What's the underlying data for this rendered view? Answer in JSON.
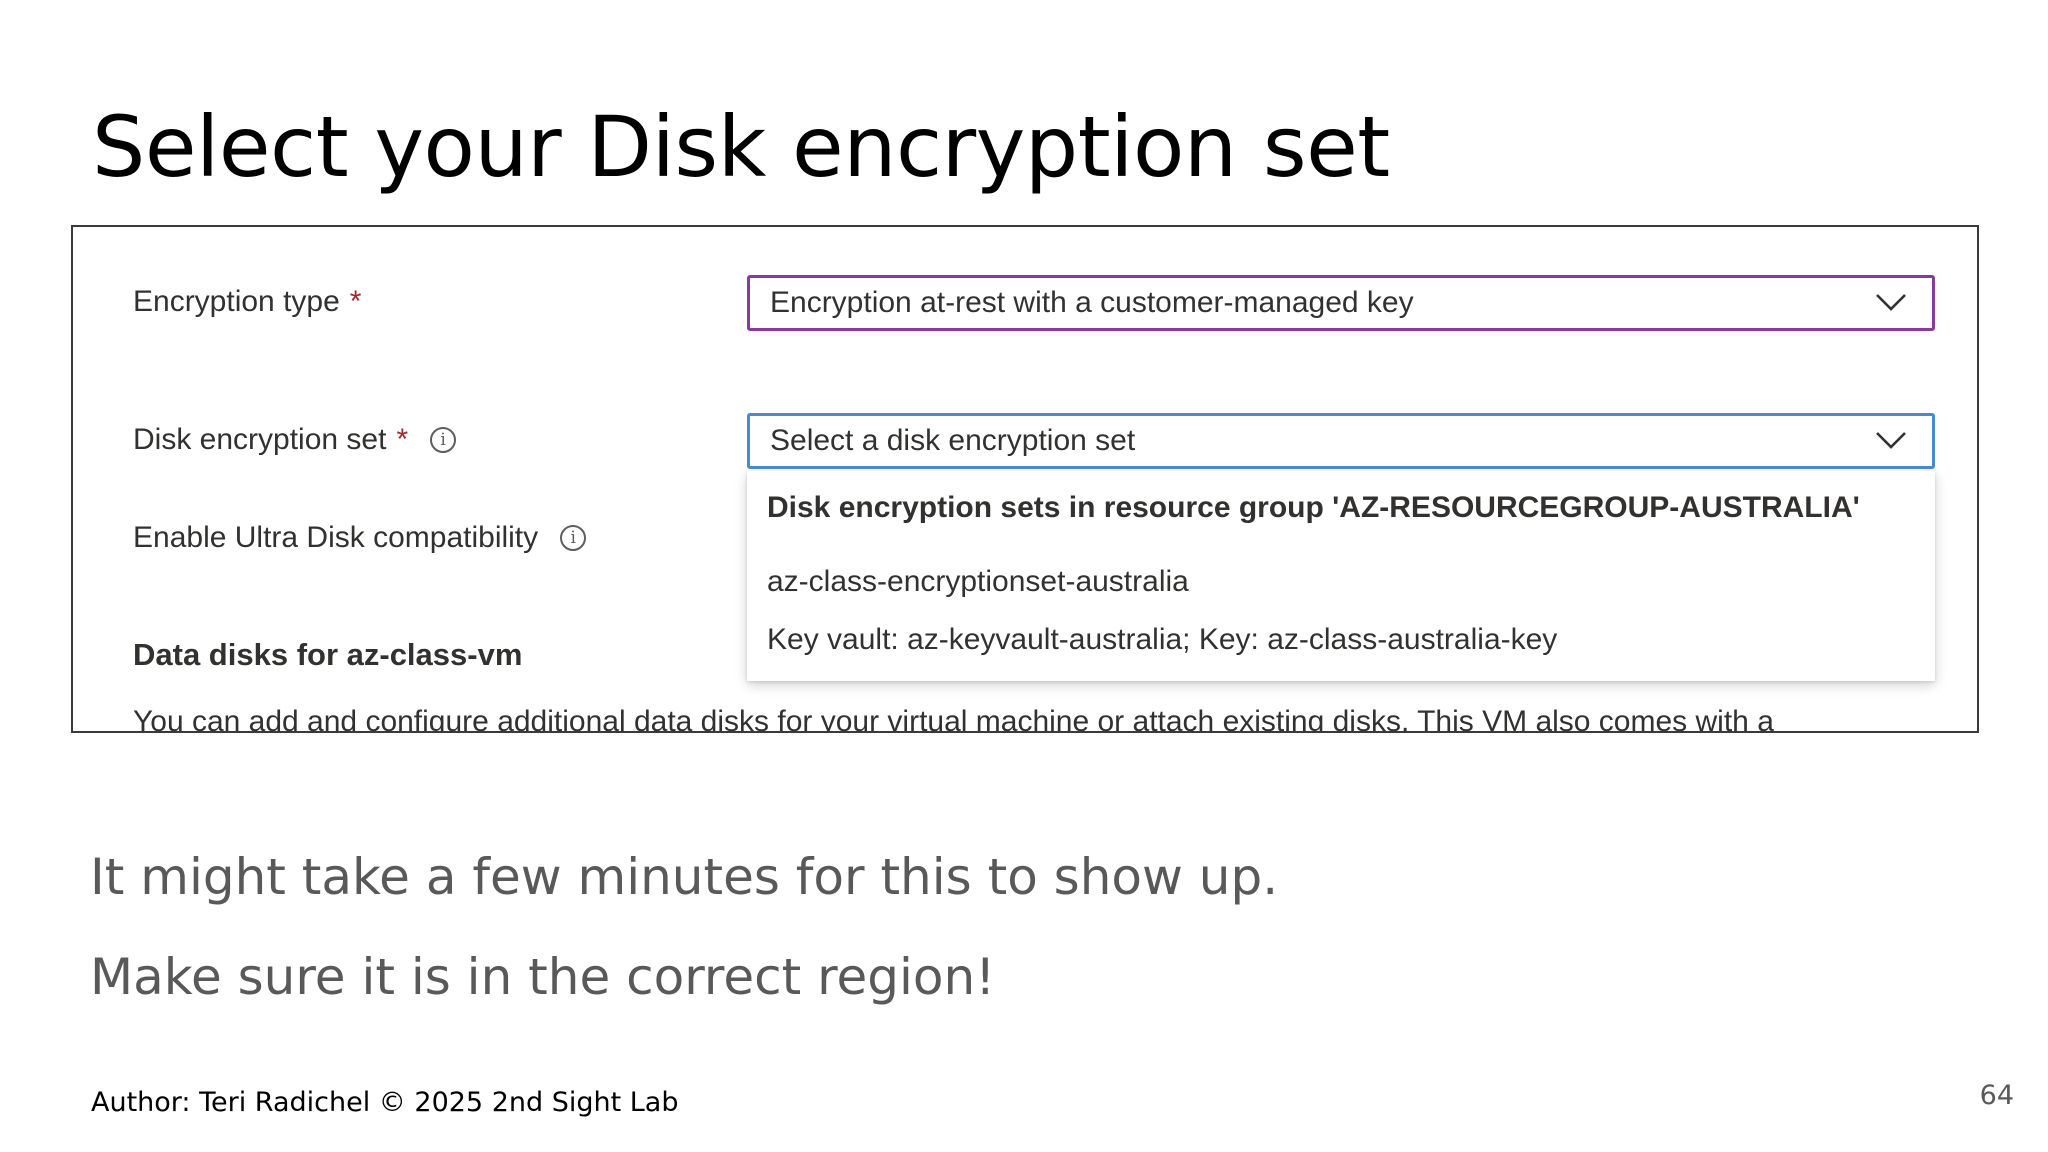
{
  "slide": {
    "title": "Select your Disk encryption set",
    "notes": [
      "It might take a few minutes for this to show up.",
      "Make sure it is in the correct region!"
    ],
    "author": "Author: Teri Radichel © 2025 2nd Sight Lab",
    "page_number": "64"
  },
  "form": {
    "encryption_type": {
      "label": "Encryption type",
      "required_mark": "*",
      "value": "Encryption at-rest with a customer-managed key"
    },
    "disk_encryption_set": {
      "label": "Disk encryption set",
      "required_mark": "*",
      "info_glyph": "i",
      "placeholder": "Select a disk encryption set",
      "menu": {
        "group_header": "Disk encryption sets in resource group 'AZ-RESOURCEGROUP-AUSTRALIA'",
        "options": [
          {
            "name": "az-class-encryptionset-australia",
            "detail": "Key vault: az-keyvault-australia; Key: az-class-australia-key"
          }
        ]
      }
    },
    "ultra_disk": {
      "label": "Enable Ultra Disk compatibility",
      "info_glyph": "i"
    },
    "data_disks": {
      "heading": "Data disks for az-class-vm",
      "description": "You can add and configure additional data disks for your virtual machine or attach existing disks. This VM also comes with a"
    }
  },
  "colors": {
    "encryption_type_border": "#8a3a9e",
    "disk_set_border_focus": "#4a8ad0",
    "required": "#a4262c",
    "body_text": "#595959"
  },
  "icons": {
    "dropdown": "chevron-down-icon",
    "info": "info-icon"
  }
}
